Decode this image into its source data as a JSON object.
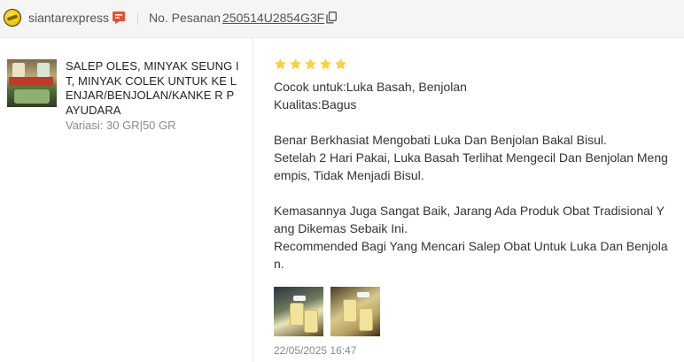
{
  "header": {
    "shop_name": "siantarexpress",
    "order_label": "No. Pesanan",
    "order_number": "250514U2854G3F",
    "icons": {
      "chat": "chat-icon",
      "copy": "copy-icon"
    },
    "accent_color": "#ee4d2d"
  },
  "product": {
    "title": "SALEP OLES, MINYAK SEUNG IT, MINYAK COLEK UNTUK KE LENJAR/BENJOLAN/KANKE R PAYUDARA",
    "variant": "Variasi: 30 GR|50 GR",
    "thumbnail_text": "MINYAK COLEK"
  },
  "review": {
    "rating": 5,
    "star_color": "#ffce3d",
    "attributes": [
      "Cocok untuk:Luka Basah, Benjolan",
      "Kualitas:Bagus"
    ],
    "body": "Benar Berkhasiat Mengobati Luka Dan Benjolan Bakal Bisul.\nSetelah 2 Hari Pakai, Luka Basah Terlihat Mengecil Dan Benjolan Meng empis, Tidak Menjadi Bisul.\n\nKemasannya Juga Sangat Baik, Jarang Ada Produk Obat Tradisional Y ang Dikemas Sebaik Ini.\nRecommended Bagi Yang Mencari Salep Obat Untuk Luka Dan Benjola n.",
    "photos": [
      "review-photo-1",
      "review-photo-2"
    ],
    "date": "22/05/2025 16:47"
  }
}
